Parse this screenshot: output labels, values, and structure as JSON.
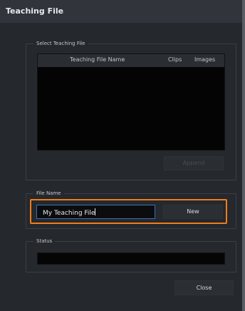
{
  "window": {
    "title": "Teaching File"
  },
  "select_group": {
    "legend": "Select Teaching File",
    "columns": [
      "Teaching File Name",
      "Clips",
      "Images"
    ],
    "rows": [],
    "append_label": "Append"
  },
  "file_name_group": {
    "legend": "File Name",
    "input_value": "My Teaching File",
    "new_label": "New"
  },
  "status_group": {
    "legend": "Status",
    "status_text": ""
  },
  "footer": {
    "close_label": "Close"
  },
  "colors": {
    "highlight": "#f07c1a",
    "input_focus_border": "#3d6fb6"
  }
}
